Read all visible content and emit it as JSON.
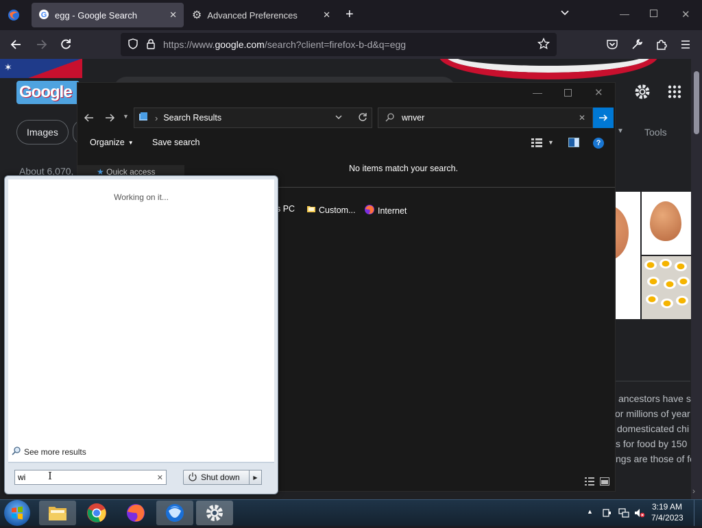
{
  "firefox": {
    "tabs": [
      {
        "label": "egg - Google Search",
        "active": true
      },
      {
        "label": "Advanced Preferences",
        "active": false
      }
    ],
    "url_prefix": "https://www.",
    "url_domain": "google.com",
    "url_rest": "/search?client=firefox-b-d&q=egg"
  },
  "google": {
    "logo": "Google",
    "chip_images": "Images",
    "tools": "Tools",
    "result_count": "About 6,070,",
    "snippets": [
      "ancestors have s",
      "or millions of year",
      "domesticated chi",
      "s for food by 150",
      "ngs are those of fo"
    ]
  },
  "explorer": {
    "breadcrumb": "Search Results",
    "search_value": "wnver",
    "organize": "Organize",
    "save_search": "Save search",
    "nav_partial": "Quick access",
    "no_items": "No items match your search.",
    "locations": [
      "s PC",
      "Custom...",
      "Internet"
    ]
  },
  "start_menu": {
    "status": "Working on it...",
    "see_more": "See more results",
    "search_value": "wi",
    "shutdown": "Shut down"
  },
  "taskbar": {
    "time": "3:19 AM",
    "date": "7/4/2023"
  },
  "colors": {
    "accent_blue": "#0078d4",
    "firefox_tab_active": "#42414d",
    "explorer_bg": "#191919"
  }
}
